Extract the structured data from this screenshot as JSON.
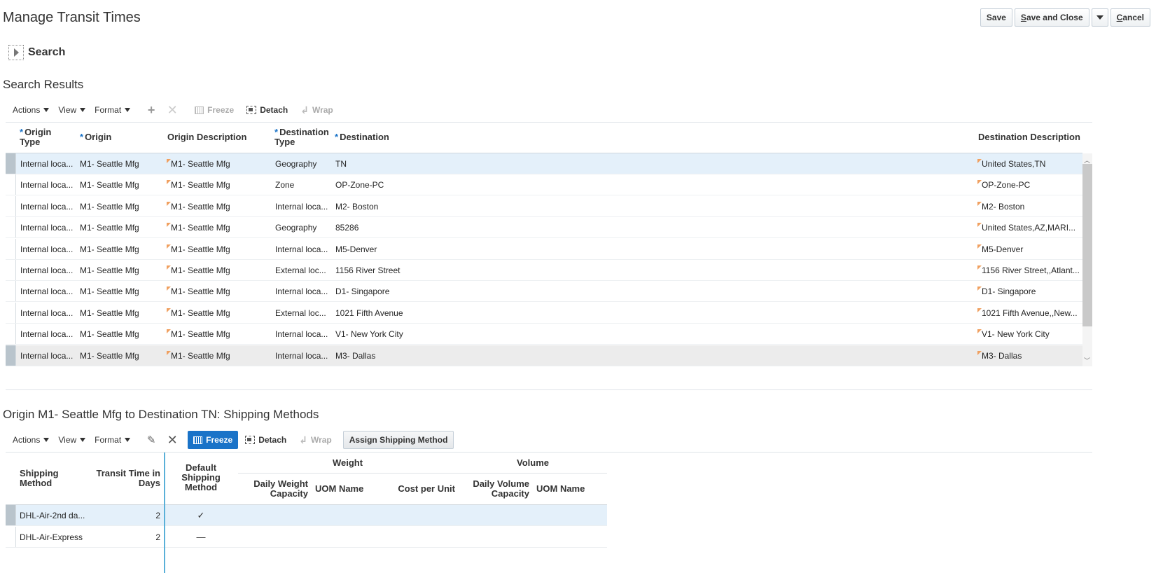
{
  "page": {
    "title": "Manage Transit Times",
    "buttons": {
      "save": "Save",
      "save_close_prefix": "S",
      "save_close_rest": "ave and Close",
      "cancel_prefix": "C",
      "cancel_rest": "ancel"
    }
  },
  "search": {
    "label": "Search"
  },
  "results": {
    "title": "Search Results",
    "toolbar": {
      "actions": "Actions",
      "view": "View",
      "format": "Format",
      "freeze": "Freeze",
      "detach": "Detach",
      "wrap": "Wrap"
    },
    "columns": {
      "origin_type_1": "Origin",
      "origin_type_2": "Type",
      "origin": "Origin",
      "origin_desc": "Origin Description",
      "dest_type_1": "Destination",
      "dest_type_2": "Type",
      "destination": "Destination",
      "dest_desc": "Destination Description",
      "required_marker": "*"
    },
    "rows": [
      {
        "origin_type": "Internal loca...",
        "origin": "M1- Seattle Mfg",
        "origin_desc": "M1- Seattle Mfg",
        "dest_type": "Geography",
        "destination": "TN",
        "dest_desc": "United States,TN"
      },
      {
        "origin_type": "Internal loca...",
        "origin": "M1- Seattle Mfg",
        "origin_desc": "M1- Seattle Mfg",
        "dest_type": "Zone",
        "destination": "OP-Zone-PC",
        "dest_desc": "OP-Zone-PC"
      },
      {
        "origin_type": "Internal loca...",
        "origin": "M1- Seattle Mfg",
        "origin_desc": "M1- Seattle Mfg",
        "dest_type": "Internal loca...",
        "destination": "M2- Boston",
        "dest_desc": "M2- Boston"
      },
      {
        "origin_type": "Internal loca...",
        "origin": "M1- Seattle Mfg",
        "origin_desc": "M1- Seattle Mfg",
        "dest_type": "Geography",
        "destination": "85286",
        "dest_desc": "United States,AZ,MARI..."
      },
      {
        "origin_type": "Internal loca...",
        "origin": "M1- Seattle Mfg",
        "origin_desc": "M1- Seattle Mfg",
        "dest_type": "Internal loca...",
        "destination": "M5-Denver",
        "dest_desc": "M5-Denver"
      },
      {
        "origin_type": "Internal loca...",
        "origin": "M1- Seattle Mfg",
        "origin_desc": "M1- Seattle Mfg",
        "dest_type": "External loc...",
        "destination": "1156 River Street",
        "dest_desc": "1156 River Street,,Atlant..."
      },
      {
        "origin_type": "Internal loca...",
        "origin": "M1- Seattle Mfg",
        "origin_desc": "M1- Seattle Mfg",
        "dest_type": "Internal loca...",
        "destination": "D1- Singapore",
        "dest_desc": "D1- Singapore"
      },
      {
        "origin_type": "Internal loca...",
        "origin": "M1- Seattle Mfg",
        "origin_desc": "M1- Seattle Mfg",
        "dest_type": "External loc...",
        "destination": "1021 Fifth Avenue",
        "dest_desc": "1021 Fifth Avenue,,New..."
      },
      {
        "origin_type": "Internal loca...",
        "origin": "M1- Seattle Mfg",
        "origin_desc": "M1- Seattle Mfg",
        "dest_type": "Internal loca...",
        "destination": "V1- New York City",
        "dest_desc": "V1- New York City"
      },
      {
        "origin_type": "Internal loca...",
        "origin": "M1- Seattle Mfg",
        "origin_desc": "M1- Seattle Mfg",
        "dest_type": "Internal loca...",
        "destination": "M3- Dallas",
        "dest_desc": "M3- Dallas"
      }
    ]
  },
  "shipping": {
    "title": "Origin M1- Seattle Mfg to Destination TN: Shipping Methods",
    "toolbar": {
      "actions": "Actions",
      "view": "View",
      "format": "Format",
      "freeze": "Freeze",
      "detach": "Detach",
      "wrap": "Wrap",
      "assign": "Assign Shipping Method"
    },
    "columns": {
      "method_1": "Shipping",
      "method_2": "Method",
      "transit_1": "Transit Time in",
      "transit_2": "Days",
      "default_1": "Default",
      "default_2": "Shipping",
      "default_3": "Method",
      "weight": "Weight",
      "daily_weight_1": "Daily Weight",
      "daily_weight_2": "Capacity",
      "weight_uom": "UOM Name",
      "cost": "Cost per Unit",
      "volume": "Volume",
      "daily_volume_1": "Daily Volume",
      "daily_volume_2": "Capacity",
      "volume_uom": "UOM Name"
    },
    "rows": [
      {
        "method": "DHL-Air-2nd da...",
        "transit": "2",
        "default": "✓"
      },
      {
        "method": "DHL-Air-Express",
        "transit": "2",
        "default": "—"
      }
    ]
  }
}
